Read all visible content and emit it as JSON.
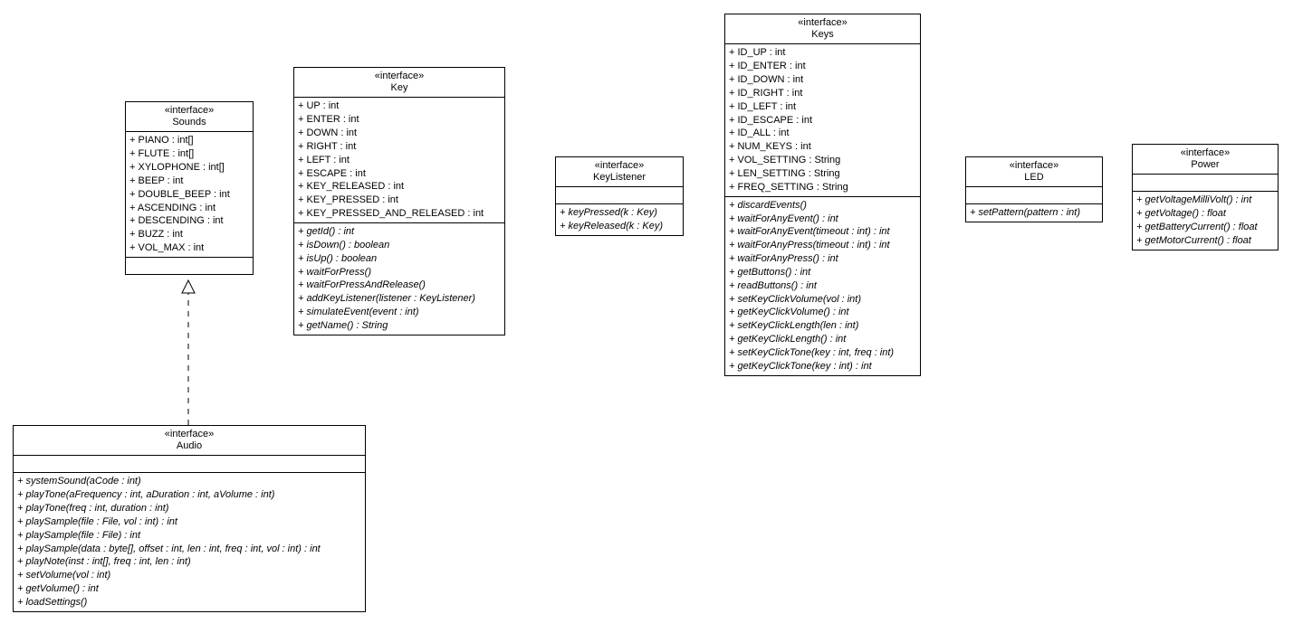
{
  "stereotype": "«interface»",
  "sounds": {
    "name": "Sounds",
    "attrs": [
      "+ PIANO : int[]",
      "+ FLUTE : int[]",
      "+ XYLOPHONE : int[]",
      "+ BEEP : int",
      "+ DOUBLE_BEEP : int",
      "+ ASCENDING : int",
      "+ DESCENDING : int",
      "+ BUZZ : int",
      "+ VOL_MAX : int"
    ]
  },
  "key": {
    "name": "Key",
    "attrs": [
      "+ UP : int",
      "+ ENTER : int",
      "+ DOWN : int",
      "+ RIGHT : int",
      "+ LEFT : int",
      "+ ESCAPE : int",
      "+ KEY_RELEASED : int",
      "+ KEY_PRESSED : int",
      "+ KEY_PRESSED_AND_RELEASED : int"
    ],
    "ops": [
      "+ getId() : int",
      "+ isDown() : boolean",
      "+ isUp() : boolean",
      "+ waitForPress()",
      "+ waitForPressAndRelease()",
      "+ addKeyListener(listener : KeyListener)",
      "+ simulateEvent(event : int)",
      "+ getName() : String"
    ]
  },
  "keylistener": {
    "name": "KeyListener",
    "ops": [
      "+ keyPressed(k : Key)",
      "+ keyReleased(k : Key)"
    ]
  },
  "keys": {
    "name": "Keys",
    "attrs": [
      "+ ID_UP : int",
      "+ ID_ENTER : int",
      "+ ID_DOWN : int",
      "+ ID_RIGHT : int",
      "+ ID_LEFT : int",
      "+ ID_ESCAPE : int",
      "+ ID_ALL : int",
      "+ NUM_KEYS : int",
      "+ VOL_SETTING : String",
      "+ LEN_SETTING : String",
      "+ FREQ_SETTING : String"
    ],
    "ops": [
      "+ discardEvents()",
      "+ waitForAnyEvent() : int",
      "+ waitForAnyEvent(timeout : int) : int",
      "+ waitForAnyPress(timeout : int) : int",
      "+ waitForAnyPress() : int",
      "+ getButtons() : int",
      "+ readButtons() : int",
      "+ setKeyClickVolume(vol : int)",
      "+ getKeyClickVolume() : int",
      "+ setKeyClickLength(len : int)",
      "+ getKeyClickLength() : int",
      "+ setKeyClickTone(key : int, freq : int)",
      "+ getKeyClickTone(key : int) : int"
    ]
  },
  "led": {
    "name": "LED",
    "ops": [
      "+ setPattern(pattern : int)"
    ]
  },
  "power": {
    "name": "Power",
    "ops": [
      "+ getVoltageMilliVolt() : int",
      "+ getVoltage() : float",
      "+ getBatteryCurrent() : float",
      "+ getMotorCurrent() : float"
    ]
  },
  "audio": {
    "name": "Audio",
    "ops": [
      "+ systemSound(aCode : int)",
      "+ playTone(aFrequency : int, aDuration : int, aVolume : int)",
      "+ playTone(freq : int, duration : int)",
      "+ playSample(file : File, vol : int) : int",
      "+ playSample(file : File) : int",
      "+ playSample(data : byte[], offset : int, len : int, freq : int, vol : int) : int",
      "+ playNote(inst : int[], freq : int, len : int)",
      "+ setVolume(vol : int)",
      "+ getVolume() : int",
      "+ loadSettings()"
    ]
  },
  "chart_data": {
    "type": "uml-class-diagram",
    "interfaces": [
      {
        "name": "Sounds",
        "attributes": [
          "PIANO:int[]",
          "FLUTE:int[]",
          "XYLOPHONE:int[]",
          "BEEP:int",
          "DOUBLE_BEEP:int",
          "ASCENDING:int",
          "DESCENDING:int",
          "BUZZ:int",
          "VOL_MAX:int"
        ],
        "operations": []
      },
      {
        "name": "Key",
        "attributes": [
          "UP:int",
          "ENTER:int",
          "DOWN:int",
          "RIGHT:int",
          "LEFT:int",
          "ESCAPE:int",
          "KEY_RELEASED:int",
          "KEY_PRESSED:int",
          "KEY_PRESSED_AND_RELEASED:int"
        ],
        "operations": [
          "getId():int",
          "isDown():boolean",
          "isUp():boolean",
          "waitForPress()",
          "waitForPressAndRelease()",
          "addKeyListener(listener:KeyListener)",
          "simulateEvent(event:int)",
          "getName():String"
        ]
      },
      {
        "name": "KeyListener",
        "attributes": [],
        "operations": [
          "keyPressed(k:Key)",
          "keyReleased(k:Key)"
        ]
      },
      {
        "name": "Keys",
        "attributes": [
          "ID_UP:int",
          "ID_ENTER:int",
          "ID_DOWN:int",
          "ID_RIGHT:int",
          "ID_LEFT:int",
          "ID_ESCAPE:int",
          "ID_ALL:int",
          "NUM_KEYS:int",
          "VOL_SETTING:String",
          "LEN_SETTING:String",
          "FREQ_SETTING:String"
        ],
        "operations": [
          "discardEvents()",
          "waitForAnyEvent():int",
          "waitForAnyEvent(timeout:int):int",
          "waitForAnyPress(timeout:int):int",
          "waitForAnyPress():int",
          "getButtons():int",
          "readButtons():int",
          "setKeyClickVolume(vol:int)",
          "getKeyClickVolume():int",
          "setKeyClickLength(len:int)",
          "getKeyClickLength():int",
          "setKeyClickTone(key:int,freq:int)",
          "getKeyClickTone(key:int):int"
        ]
      },
      {
        "name": "LED",
        "attributes": [],
        "operations": [
          "setPattern(pattern:int)"
        ]
      },
      {
        "name": "Power",
        "attributes": [],
        "operations": [
          "getVoltageMilliVolt():int",
          "getVoltage():float",
          "getBatteryCurrent():float",
          "getMotorCurrent():float"
        ]
      },
      {
        "name": "Audio",
        "attributes": [],
        "operations": [
          "systemSound(aCode:int)",
          "playTone(aFrequency:int,aDuration:int,aVolume:int)",
          "playTone(freq:int,duration:int)",
          "playSample(file:File,vol:int):int",
          "playSample(file:File):int",
          "playSample(data:byte[],offset:int,len:int,freq:int,vol:int):int",
          "playNote(inst:int[],freq:int,len:int)",
          "setVolume(vol:int)",
          "getVolume():int",
          "loadSettings()"
        ]
      }
    ],
    "relationships": [
      {
        "from": "Audio",
        "to": "Sounds",
        "type": "realization"
      }
    ]
  }
}
